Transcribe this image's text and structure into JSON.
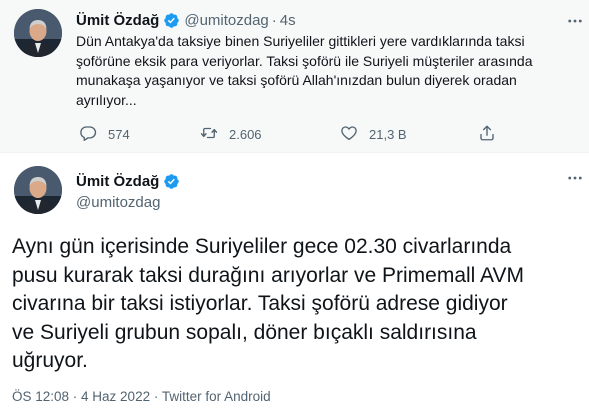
{
  "top_tweet": {
    "display_name": "Ümit Özdağ",
    "handle": "@umitozdag",
    "separator": "·",
    "time": "4s",
    "text_lines": [
      "Dün Antakya'da taksiye binen Suriyeliler gittikleri yere vardıklarında taksi",
      "şoförüne eksik para veriyorlar. Taksi şoförü ile Suriyeli müşteriler arasında",
      "munakaşa yaşanıyor ve taksi şoförü Allah'ınızdan bulun diyerek oradan",
      "ayrılıyor..."
    ],
    "actions": {
      "reply_count": "574",
      "retweet_count": "2.606",
      "like_count": "21,3 B"
    }
  },
  "main_tweet": {
    "display_name": "Ümit Özdağ",
    "handle": "@umitozdag",
    "text_lines": [
      "Aynı gün içerisinde Suriyeliler gece 02.30 civarlarında",
      "pusu kurarak taksi durağını arıyorlar ve Primemall AVM",
      "civarına bir taksi istiyorlar. Taksi şoförü adrese gidiyor",
      "ve Suriyeli grubun sopalı, döner bıçaklı saldırısına",
      "uğruyor."
    ],
    "meta": "ÖS 12:08 · 4 Haz 2022 · Twitter for Android"
  },
  "icons": {
    "verified": "verified-badge-icon",
    "more": "more-options-icon",
    "reply": "reply-icon",
    "retweet": "retweet-icon",
    "like": "heart-icon",
    "share": "share-icon"
  },
  "colors": {
    "verified_blue": "#1d9bf0",
    "secondary_text": "#536471",
    "primary_text": "#0f1419",
    "top_background": "#f7f9f9"
  }
}
